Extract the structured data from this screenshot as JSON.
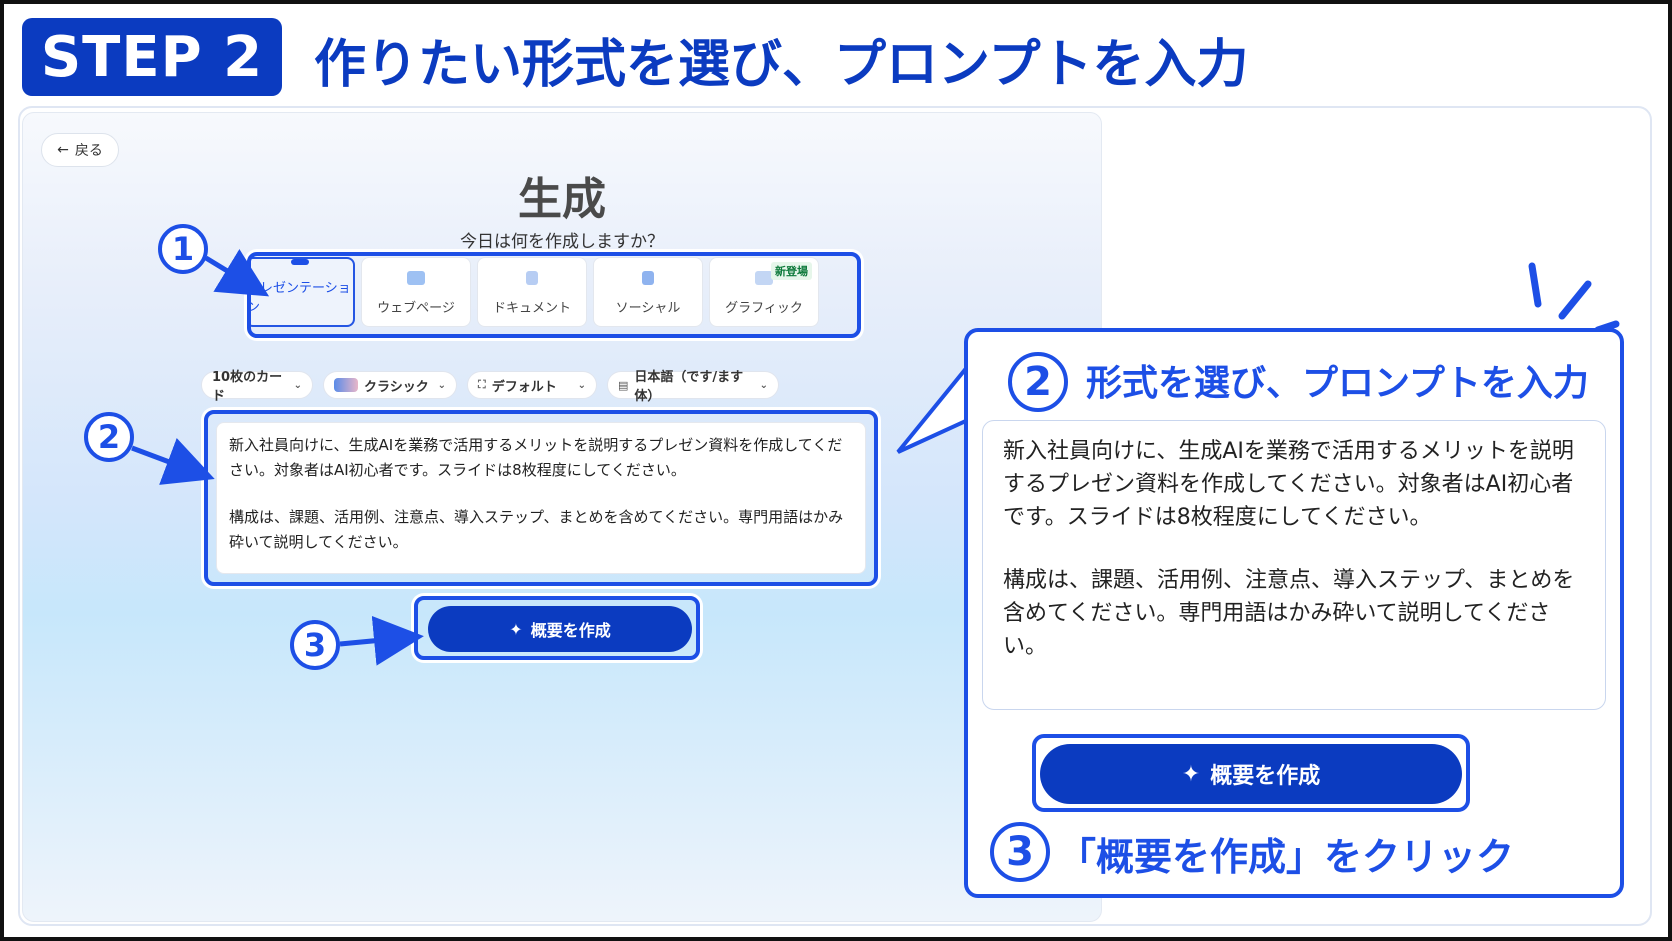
{
  "header": {
    "step_label": "STEP 2",
    "headline": "作りたい形式を選び、プロンプトを入力"
  },
  "app": {
    "back_label": "戻る",
    "title": "生成",
    "subtitle": "今日は何を作成しますか？",
    "formats": [
      {
        "label": "プレゼンテーション",
        "icon": "presentation-icon",
        "selected": true
      },
      {
        "label": "ウェブページ",
        "icon": "webpage-icon"
      },
      {
        "label": "ドキュメント",
        "icon": "document-icon"
      },
      {
        "label": "ソーシャル",
        "icon": "social-icon"
      },
      {
        "label": "グラフィック",
        "icon": "graphic-icon",
        "badge": "新登場"
      }
    ],
    "options": [
      {
        "label": "10枚のカード"
      },
      {
        "label": "クラシック"
      },
      {
        "label": "デフォルト"
      },
      {
        "label": "日本語（です/ます体）"
      }
    ],
    "prompt_p1": "新入社員向けに、生成AIを業務で活用するメリットを説明するプレゼン資料を作成してください。対象者はAI初心者です。スライドは8枚程度にしてください。",
    "prompt_p2": "構成は、課題、活用例、注意点、導入ステップ、まとめを含めてください。専門用語はかみ砕いて説明してください。",
    "generate_label": "概要を作成"
  },
  "markers": {
    "one": "1",
    "two": "2",
    "three": "3"
  },
  "callout": {
    "title": "形式を選び、プロンプトを入力",
    "prompt_p1": "新入社員向けに、生成AIを業務で活用するメリットを説明するプレゼン資料を作成してください。対象者はAI初心者です。スライドは8枚程度にしてください。",
    "prompt_p2": "構成は、課題、活用例、注意点、導入ステップ、まとめを含めてください。専門用語はかみ砕いて説明してください。",
    "generate_label": "概要を作成",
    "click_label": "「概要を作成」をクリック"
  },
  "colors": {
    "brand_blue": "#0b3bc0",
    "accent_blue": "#1d4fe6"
  }
}
